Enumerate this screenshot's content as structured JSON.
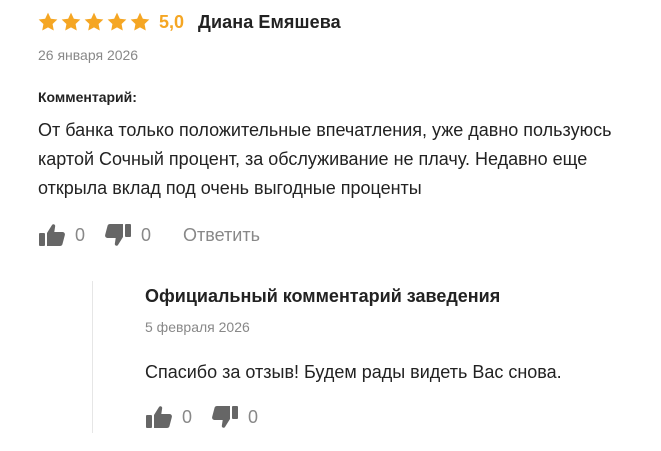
{
  "review": {
    "rating": 5,
    "rating_label": "5,0",
    "author": "Диана Емяшева",
    "date": "26 января 2026",
    "comment_label": "Комментарий:",
    "comment_text": "От банка только положительные впечатления, уже давно пользуюсь картой Сочный процент, за обслуживание не плачу. Недавно еще открыла вклад под очень выгодные проценты",
    "likes": "0",
    "dislikes": "0",
    "reply_label": "Ответить"
  },
  "official_reply": {
    "title": "Официальный комментарий заведения",
    "date": "5 февраля 2026",
    "text": "Спасибо за отзыв! Будем рады видеть Вас снова.",
    "likes": "0",
    "dislikes": "0"
  },
  "colors": {
    "star": "#f5a623",
    "icon": "#666666",
    "muted_text": "#888888",
    "divider": "#e6e6e6"
  },
  "icons": {
    "star": "star-icon",
    "like": "thumbs-up-icon",
    "dislike": "thumbs-down-icon"
  }
}
